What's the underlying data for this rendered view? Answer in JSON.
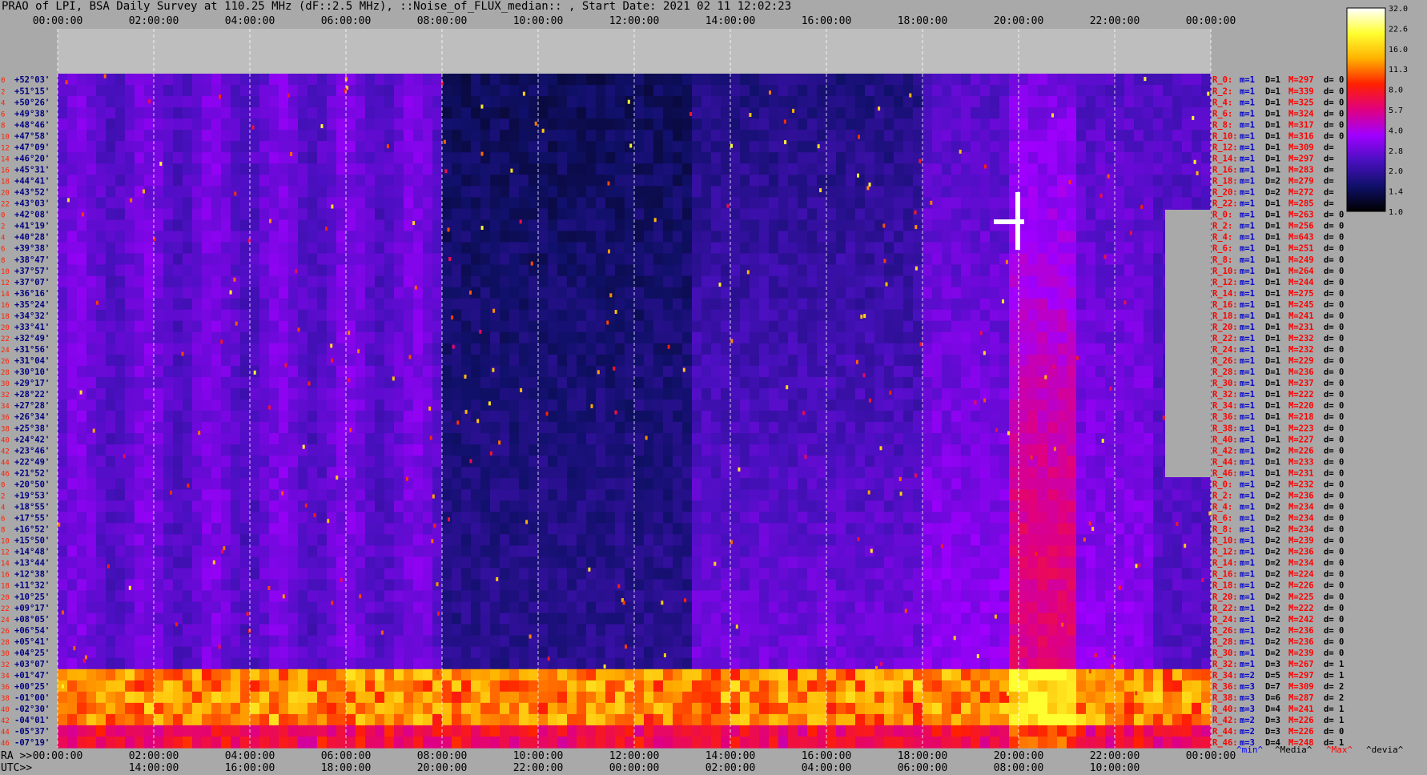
{
  "title": "PRAO of LPI, BSA Daily Survey at 110.25 MHz (dF::2.5 MHz), ::Noise_of_FLUX_median:: , Start Date: 2021 02 11 12:02:23",
  "colorbar": {
    "labels": [
      "32.0",
      "22.6",
      "16.0",
      "11.3",
      "8.0",
      "5.7",
      "4.0",
      "2.8",
      "2.0",
      "1.4",
      "1.0"
    ],
    "colors": [
      "#ffffff",
      "#ffff30",
      "#ffb000",
      "#ff2000",
      "#e00080",
      "#a000ff",
      "#4a10c0",
      "#10106a",
      "#000000"
    ]
  },
  "footer": {
    "ra_prefix": "RA >>",
    "utc_prefix": "UTC>>",
    "legend": {
      "min": "^min^",
      "median": "^Media^",
      "max": "^Max^",
      "devia": "^devia^"
    },
    "legend_colors": {
      "min": "#0000ff",
      "median": "#000000",
      "max": "#ff0000",
      "devia": "#000000"
    }
  },
  "chart_data": {
    "type": "heatmap",
    "top_time_ticks": [
      "00:00:00",
      "02:00:00",
      "04:00:00",
      "06:00:00",
      "08:00:00",
      "10:00:00",
      "12:00:00",
      "14:00:00",
      "16:00:00",
      "18:00:00",
      "20:00:00",
      "22:00:00",
      "00:00:00"
    ],
    "ra_ticks": [
      "00:00:00",
      "02:00:00",
      "04:00:00",
      "06:00:00",
      "08:00:00",
      "10:00:00",
      "12:00:00",
      "14:00:00",
      "16:00:00",
      "18:00:00",
      "20:00:00",
      "22:00:00",
      "00:00:00"
    ],
    "utc_ticks": [
      "14:00:00",
      "16:00:00",
      "18:00:00",
      "20:00:00",
      "22:00:00",
      "00:00:00",
      "02:00:00",
      "04:00:00",
      "06:00:00",
      "08:00:00",
      "10:00:00"
    ],
    "row_numbers": [
      "0",
      "2",
      "4",
      "6",
      "8",
      "10",
      "12",
      "14",
      "16",
      "18",
      "20",
      "22",
      "0",
      "2",
      "4",
      "6",
      "8",
      "10",
      "12",
      "14",
      "16",
      "18",
      "20",
      "22",
      "24",
      "26",
      "28",
      "30",
      "32",
      "34",
      "36",
      "38",
      "40",
      "42",
      "44",
      "46",
      "0",
      "2",
      "4",
      "6",
      "8",
      "10",
      "12",
      "14",
      "16",
      "18",
      "20",
      "22",
      "24",
      "26",
      "28",
      "30",
      "32",
      "34",
      "36",
      "38",
      "40",
      "42",
      "44",
      "46"
    ],
    "declinations": [
      "+52°03'",
      "+51°15'",
      "+50°26'",
      "+49°38'",
      "+48°46'",
      "+47°58'",
      "+47°09'",
      "+46°20'",
      "+45°31'",
      "+44°41'",
      "+43°52'",
      "+43°03'",
      "+42°08'",
      "+41°19'",
      "+40°28'",
      "+39°38'",
      "+38°47'",
      "+37°57'",
      "+37°07'",
      "+36°16'",
      "+35°24'",
      "+34°32'",
      "+33°41'",
      "+32°49'",
      "+31°56'",
      "+31°04'",
      "+30°10'",
      "+29°17'",
      "+28°22'",
      "+27°28'",
      "+26°34'",
      "+25°38'",
      "+24°42'",
      "+23°46'",
      "+22°49'",
      "+21°52'",
      "+20°50'",
      "+19°53'",
      "+18°55'",
      "+17°55'",
      "+16°52'",
      "+15°50'",
      "+14°48'",
      "+13°44'",
      "+12°38'",
      "+11°32'",
      "+10°25'",
      "+09°17'",
      "+08°05'",
      "+06°54'",
      "+05°41'",
      "+04°25'",
      "+03°07'",
      "+01°47'",
      "+00°25'",
      "-01°00'",
      "-02°30'",
      "-04°01'",
      "-05°37'",
      "-07°19'"
    ],
    "channel_stats": [
      {
        "r": "R_0:",
        "m": "m=1",
        "d": "D=1",
        "max": "M=297",
        "dev": "d= 0"
      },
      {
        "r": "R_2:",
        "m": "m=1",
        "d": "D=1",
        "max": "M=339",
        "dev": "d= 0"
      },
      {
        "r": "R_4:",
        "m": "m=1",
        "d": "D=1",
        "max": "M=325",
        "dev": "d= 0"
      },
      {
        "r": "R_6:",
        "m": "m=1",
        "d": "D=1",
        "max": "M=324",
        "dev": "d= 0"
      },
      {
        "r": "R_8:",
        "m": "m=1",
        "d": "D=1",
        "max": "M=317",
        "dev": "d= 0"
      },
      {
        "r": "R_10:",
        "m": "m=1",
        "d": "D=1",
        "max": "M=316",
        "dev": "d= 0"
      },
      {
        "r": "R_12:",
        "m": "m=1",
        "d": "D=1",
        "max": "M=309",
        "dev": "d="
      },
      {
        "r": "R_14:",
        "m": "m=1",
        "d": "D=1",
        "max": "M=297",
        "dev": "d="
      },
      {
        "r": "R_16:",
        "m": "m=1",
        "d": "D=1",
        "max": "M=283",
        "dev": "d="
      },
      {
        "r": "R_18:",
        "m": "m=1",
        "d": "D=2",
        "max": "M=279",
        "dev": "d="
      },
      {
        "r": "R_20:",
        "m": "m=1",
        "d": "D=2",
        "max": "M=272",
        "dev": "d="
      },
      {
        "r": "R_22:",
        "m": "m=1",
        "d": "D=1",
        "max": "M=285",
        "dev": "d="
      },
      {
        "r": "R_0:",
        "m": "m=1",
        "d": "D=1",
        "max": "M=263",
        "dev": "d= 0"
      },
      {
        "r": "R_2:",
        "m": "m=1",
        "d": "D=1",
        "max": "M=256",
        "dev": "d= 0"
      },
      {
        "r": "R_4:",
        "m": "m=1",
        "d": "D=1",
        "max": "M=643",
        "dev": "d= 0"
      },
      {
        "r": "R_6:",
        "m": "m=1",
        "d": "D=1",
        "max": "M=251",
        "dev": "d= 0"
      },
      {
        "r": "R_8:",
        "m": "m=1",
        "d": "D=1",
        "max": "M=249",
        "dev": "d= 0"
      },
      {
        "r": "R_10:",
        "m": "m=1",
        "d": "D=1",
        "max": "M=264",
        "dev": "d= 0"
      },
      {
        "r": "R_12:",
        "m": "m=1",
        "d": "D=1",
        "max": "M=244",
        "dev": "d= 0"
      },
      {
        "r": "R_14:",
        "m": "m=1",
        "d": "D=1",
        "max": "M=275",
        "dev": "d= 0"
      },
      {
        "r": "R_16:",
        "m": "m=1",
        "d": "D=1",
        "max": "M=245",
        "dev": "d= 0"
      },
      {
        "r": "R_18:",
        "m": "m=1",
        "d": "D=1",
        "max": "M=241",
        "dev": "d= 0"
      },
      {
        "r": "R_20:",
        "m": "m=1",
        "d": "D=1",
        "max": "M=231",
        "dev": "d= 0"
      },
      {
        "r": "R_22:",
        "m": "m=1",
        "d": "D=1",
        "max": "M=232",
        "dev": "d= 0"
      },
      {
        "r": "R_24:",
        "m": "m=1",
        "d": "D=1",
        "max": "M=232",
        "dev": "d= 0"
      },
      {
        "r": "R_26:",
        "m": "m=1",
        "d": "D=1",
        "max": "M=229",
        "dev": "d= 0"
      },
      {
        "r": "R_28:",
        "m": "m=1",
        "d": "D=1",
        "max": "M=236",
        "dev": "d= 0"
      },
      {
        "r": "R_30:",
        "m": "m=1",
        "d": "D=1",
        "max": "M=237",
        "dev": "d= 0"
      },
      {
        "r": "R_32:",
        "m": "m=1",
        "d": "D=1",
        "max": "M=222",
        "dev": "d= 0"
      },
      {
        "r": "R_34:",
        "m": "m=1",
        "d": "D=1",
        "max": "M=220",
        "dev": "d= 0"
      },
      {
        "r": "R_36:",
        "m": "m=1",
        "d": "D=1",
        "max": "M=218",
        "dev": "d= 0"
      },
      {
        "r": "R_38:",
        "m": "m=1",
        "d": "D=1",
        "max": "M=223",
        "dev": "d= 0"
      },
      {
        "r": "R_40:",
        "m": "m=1",
        "d": "D=1",
        "max": "M=227",
        "dev": "d= 0"
      },
      {
        "r": "R_42:",
        "m": "m=1",
        "d": "D=2",
        "max": "M=226",
        "dev": "d= 0"
      },
      {
        "r": "R_44:",
        "m": "m=1",
        "d": "D=1",
        "max": "M=233",
        "dev": "d= 0"
      },
      {
        "r": "R_46:",
        "m": "m=1",
        "d": "D=1",
        "max": "M=231",
        "dev": "d= 0"
      },
      {
        "r": "R_0:",
        "m": "m=1",
        "d": "D=2",
        "max": "M=232",
        "dev": "d= 0"
      },
      {
        "r": "R_2:",
        "m": "m=1",
        "d": "D=2",
        "max": "M=236",
        "dev": "d= 0"
      },
      {
        "r": "R_4:",
        "m": "m=1",
        "d": "D=2",
        "max": "M=234",
        "dev": "d= 0"
      },
      {
        "r": "R_6:",
        "m": "m=1",
        "d": "D=2",
        "max": "M=234",
        "dev": "d= 0"
      },
      {
        "r": "R_8:",
        "m": "m=1",
        "d": "D=2",
        "max": "M=234",
        "dev": "d= 0"
      },
      {
        "r": "R_10:",
        "m": "m=1",
        "d": "D=2",
        "max": "M=239",
        "dev": "d= 0"
      },
      {
        "r": "R_12:",
        "m": "m=1",
        "d": "D=2",
        "max": "M=236",
        "dev": "d= 0"
      },
      {
        "r": "R_14:",
        "m": "m=1",
        "d": "D=2",
        "max": "M=234",
        "dev": "d= 0"
      },
      {
        "r": "R_16:",
        "m": "m=1",
        "d": "D=2",
        "max": "M=224",
        "dev": "d= 0"
      },
      {
        "r": "R_18:",
        "m": "m=1",
        "d": "D=2",
        "max": "M=226",
        "dev": "d= 0"
      },
      {
        "r": "R_20:",
        "m": "m=1",
        "d": "D=2",
        "max": "M=225",
        "dev": "d= 0"
      },
      {
        "r": "R_22:",
        "m": "m=1",
        "d": "D=2",
        "max": "M=222",
        "dev": "d= 0"
      },
      {
        "r": "R_24:",
        "m": "m=1",
        "d": "D=2",
        "max": "M=242",
        "dev": "d= 0"
      },
      {
        "r": "R_26:",
        "m": "m=1",
        "d": "D=2",
        "max": "M=236",
        "dev": "d= 0"
      },
      {
        "r": "R_28:",
        "m": "m=1",
        "d": "D=2",
        "max": "M=236",
        "dev": "d= 0"
      },
      {
        "r": "R_30:",
        "m": "m=1",
        "d": "D=2",
        "max": "M=239",
        "dev": "d= 0"
      },
      {
        "r": "R_32:",
        "m": "m=1",
        "d": "D=3",
        "max": "M=267",
        "dev": "d= 1"
      },
      {
        "r": "R_34:",
        "m": "m=2",
        "d": "D=5",
        "max": "M=297",
        "dev": "d= 1"
      },
      {
        "r": "R_36:",
        "m": "m=3",
        "d": "D=7",
        "max": "M=309",
        "dev": "d= 2"
      },
      {
        "r": "R_38:",
        "m": "m=3",
        "d": "D=6",
        "max": "M=287",
        "dev": "d= 2"
      },
      {
        "r": "R_40:",
        "m": "m=3",
        "d": "D=4",
        "max": "M=241",
        "dev": "d= 1"
      },
      {
        "r": "R_42:",
        "m": "m=2",
        "d": "D=3",
        "max": "M=226",
        "dev": "d= 1"
      },
      {
        "r": "R_44:",
        "m": "m=2",
        "d": "D=3",
        "max": "M=226",
        "dev": "d= 0"
      },
      {
        "r": "R_46:",
        "m": "m=3",
        "d": "D=4",
        "max": "M=248",
        "dev": "d= 1"
      }
    ]
  }
}
